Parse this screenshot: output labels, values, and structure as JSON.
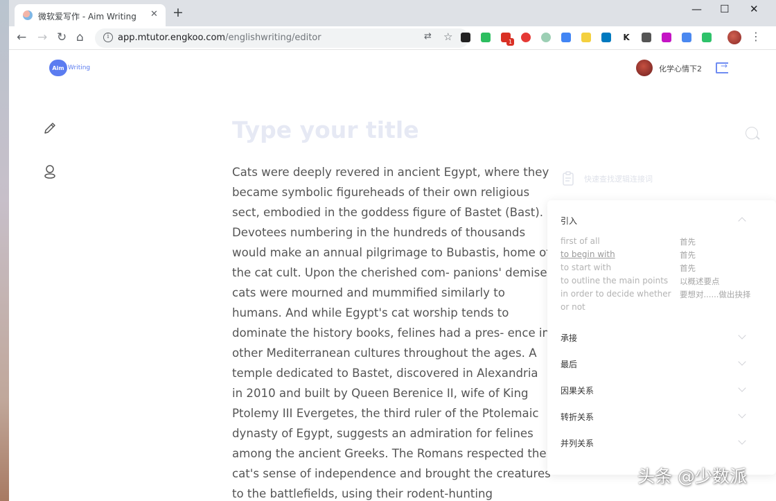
{
  "browser": {
    "tab_title": "微软爱写作 - Aim Writing",
    "tab_close": "✕",
    "new_tab": "+",
    "window_controls": {
      "minimize": "—",
      "maximize": "☐",
      "close": "✕"
    },
    "nav": {
      "back": "←",
      "forward": "→",
      "reload": "↻",
      "home": "⌂"
    },
    "url_host": "app.mtutor.engkoo.com",
    "url_path": "/englishwriting/editor",
    "omnibox_icons": {
      "translate": "⇄",
      "bookmark": "☆"
    },
    "menu": "⋮",
    "extensions": [
      {
        "name": "notion-ext-icon",
        "color": "#222222"
      },
      {
        "name": "evernote-ext-icon",
        "color": "#2dbe60"
      },
      {
        "name": "mail-ext-icon",
        "color": "#d93025"
      },
      {
        "name": "adblock-ext-icon",
        "color": "#e53935"
      },
      {
        "name": "circle-ext-icon",
        "color": "#9ccfb4"
      },
      {
        "name": "diamond-ext-icon",
        "color": "#4285f4"
      },
      {
        "name": "notes-ext-icon",
        "color": "#f4d03f"
      },
      {
        "name": "trello-ext-icon",
        "color": "#0079bf"
      },
      {
        "name": "k-ext-icon",
        "color": "#ffffff"
      },
      {
        "name": "qr-ext-icon",
        "color": "#555555"
      },
      {
        "name": "onenote-ext-icon",
        "color": "#c414c4"
      },
      {
        "name": "translate-ext-icon",
        "color": "#4a88f0"
      },
      {
        "name": "wechat-ext-icon",
        "color": "#2ec26a"
      }
    ],
    "ext_k_label": "K",
    "mail_badge": "1"
  },
  "app": {
    "logo_badge": "Aim",
    "logo_text": "Writing",
    "user_name": "化学心情下2",
    "title_placeholder": "Type your title",
    "essay": "Cats were deeply revered in ancient Egypt, where they became symbolic figureheads of their own religious sect, embodied in the goddess figure of Bastet (Bast). Devotees numbering in the hundreds of thousands would make an annual pilgrimage to Bubastis, home of the cat cult. Upon the cherished com- panions' demise, cats were mourned and mummified similarly to humans. And while Egypt's cat worship tends to dominate the history books, felines had a pres- ence in other Mediterranean cultures throughout the ages. A temple dedicated to Bastet, discovered in Alexandria in 2010 and built by Queen Berenice II, wife of King Ptolemy III Evergetes, the third ruler of the Ptolemaic dynasty of Egypt, suggests an admiration for felines among the ancient Greeks. The Romans respected the cat's sense of independence and brought the creatures to the battlefields, using their rodent-hunting proclivities to keep food supplies and",
    "clipboard_label": "快速查找逻辑连接词",
    "phrase_panel": {
      "sections": [
        {
          "title": "引入",
          "expanded": true,
          "phrases": [
            {
              "en": "first of all",
              "zh": "首先"
            },
            {
              "en": "to begin with",
              "zh": "首先",
              "link": true
            },
            {
              "en": "to start with",
              "zh": "首先"
            },
            {
              "en": "to outline the main points",
              "zh": "以概述要点"
            },
            {
              "en": "in order to decide whether",
              "en2": "or not",
              "zh": "要想对......做出抉择"
            }
          ]
        },
        {
          "title": "承接",
          "expanded": false
        },
        {
          "title": "最后",
          "expanded": false
        },
        {
          "title": "因果关系",
          "expanded": false
        },
        {
          "title": "转折关系",
          "expanded": false
        },
        {
          "title": "并列关系",
          "expanded": false
        }
      ]
    }
  },
  "watermark": "头条 @少数派"
}
